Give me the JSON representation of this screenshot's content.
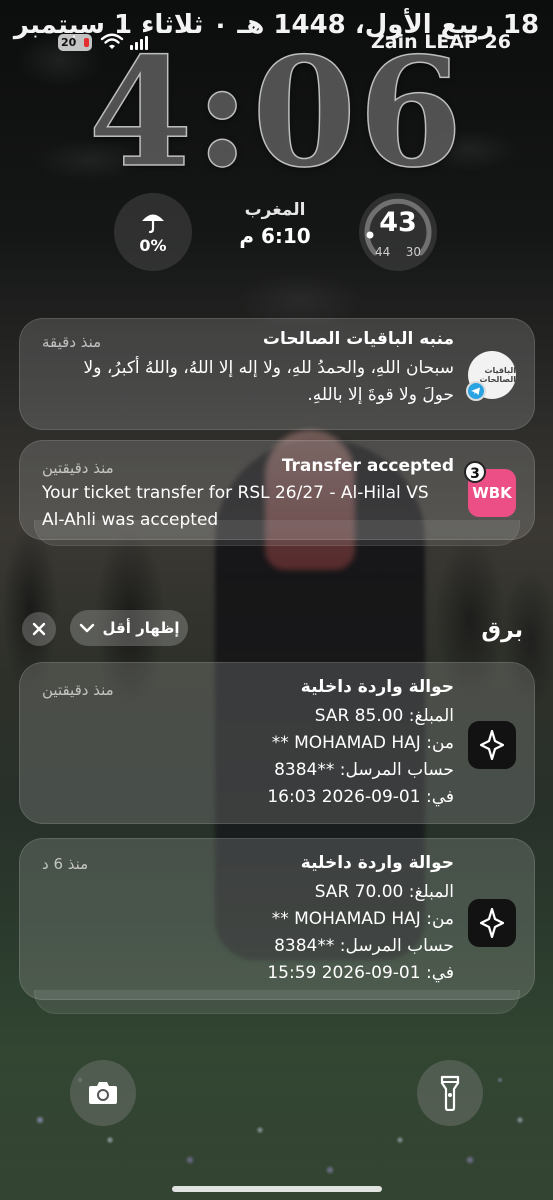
{
  "status_bar": {
    "date": "18 ربيع الأول، 1448 هـ ٠ ثلاثاء 1 سبتمبر",
    "battery": "20",
    "carrier": "Zain LEAP 26"
  },
  "clock": {
    "time": "4:06"
  },
  "widgets": {
    "rain": {
      "icon": "umbrella-icon",
      "value": "0%"
    },
    "prayer": {
      "name": "المغرب",
      "time": "6:10 م"
    },
    "temperature": {
      "current": "43",
      "low": "30",
      "high": "44"
    }
  },
  "notifications": [
    {
      "app_icon": "munbah-app-icon",
      "icon_text": "الباقيات الصالحات",
      "title": "منبه الباقيات الصالحات",
      "when": "منذ دقيقة",
      "body_lines": [
        "سبحان اللهِ، والحمدُ للهِ، ولا إله إلا اللهُ، واللهُ أكبرُ، ولا",
        "حولَ ولا قوةَ إلا باللهِ."
      ]
    },
    {
      "app_icon": "webook-app-icon",
      "icon_text": "WBK",
      "badge": "3",
      "title": "Transfer accepted",
      "when": "منذ دقيقتين",
      "body_lines": [
        "Your ticket transfer for RSL 26/27 - Al-Hilal VS",
        "Al-Ahli was accepted"
      ]
    }
  ],
  "group": {
    "title": "برق",
    "show_less": "إظهار أقل",
    "items": [
      {
        "title": "حوالة واردة داخلية",
        "when": "منذ دقيقتين",
        "lines": [
          "المبلغ: SAR 85.00",
          "من: MOHAMAD HAJ **",
          "حساب المرسل: **8384",
          "في: 01-09-2026 16:03"
        ]
      },
      {
        "title": "حوالة واردة داخلية",
        "when": "منذ 6 د",
        "lines": [
          "المبلغ: SAR 70.00",
          "من: MOHAMAD HAJ **",
          "حساب المرسل: **8384",
          "في: 01-09-2026 15:59"
        ]
      }
    ]
  },
  "bottom": {
    "camera_icon": "camera-icon",
    "flashlight_icon": "flashlight-icon"
  },
  "colors": {
    "webook": "#ec4f86",
    "telegram": "#2aa3e3",
    "battery_low": "#e52e2e"
  }
}
